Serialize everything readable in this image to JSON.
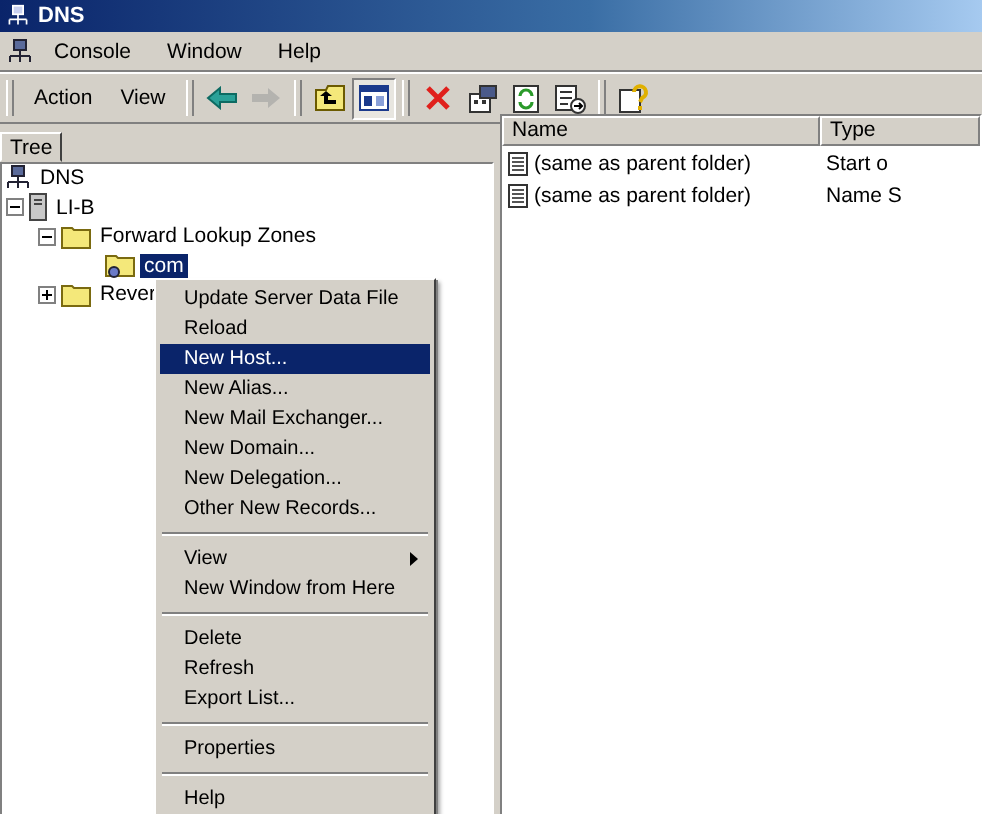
{
  "window": {
    "title": "DNS"
  },
  "menu_bar": [
    {
      "label": "Console"
    },
    {
      "label": "Window"
    },
    {
      "label": "Help"
    }
  ],
  "toolbar": {
    "menus": [
      {
        "label": "Action"
      },
      {
        "label": "View"
      }
    ],
    "buttons": [
      {
        "kind": "back",
        "disabled": false,
        "pressed": false
      },
      {
        "kind": "forward",
        "disabled": true,
        "pressed": false
      },
      {
        "kind": "up",
        "disabled": false,
        "pressed": false
      },
      {
        "kind": "tree",
        "disabled": false,
        "pressed": true
      },
      {
        "kind": "delete",
        "disabled": false,
        "pressed": false
      },
      {
        "kind": "properties",
        "disabled": false,
        "pressed": false
      },
      {
        "kind": "refresh",
        "disabled": false,
        "pressed": false
      },
      {
        "kind": "export",
        "disabled": false,
        "pressed": false
      },
      {
        "kind": "help",
        "disabled": false,
        "pressed": false
      }
    ]
  },
  "tabs": [
    {
      "label": "Tree",
      "selected": true
    }
  ],
  "tree": [
    {
      "label": "DNS",
      "kind": "dns",
      "expanded": true,
      "selected": false,
      "children": [
        {
          "label": "LI-B",
          "kind": "server",
          "expanded": true,
          "selected": false,
          "children": [
            {
              "label": "Forward Lookup Zones",
              "kind": "folder",
              "expanded": true,
              "selected": false,
              "children": [
                {
                  "label": "com",
                  "kind": "zone",
                  "selected": true
                }
              ]
            },
            {
              "label": "Rever",
              "kind": "folder",
              "expanded": false,
              "selected": false
            }
          ]
        }
      ]
    }
  ],
  "list": {
    "columns": [
      "Name",
      "Type"
    ],
    "rows": [
      {
        "name": "(same as parent folder)",
        "type": "Start o"
      },
      {
        "name": "(same as parent folder)",
        "type": "Name S"
      }
    ]
  },
  "context_menu": [
    {
      "kind": "item",
      "label": "Update Server Data File",
      "selected": false
    },
    {
      "kind": "item",
      "label": "Reload",
      "selected": false
    },
    {
      "kind": "item",
      "label": "New Host...",
      "selected": true
    },
    {
      "kind": "item",
      "label": "New Alias...",
      "selected": false
    },
    {
      "kind": "item",
      "label": "New Mail Exchanger...",
      "selected": false
    },
    {
      "kind": "item",
      "label": "New Domain...",
      "selected": false
    },
    {
      "kind": "item",
      "label": "New Delegation...",
      "selected": false
    },
    {
      "kind": "item",
      "label": "Other New Records...",
      "selected": false
    },
    {
      "kind": "separator"
    },
    {
      "kind": "submenu",
      "label": "View",
      "selected": false
    },
    {
      "kind": "item",
      "label": "New Window from Here",
      "selected": false
    },
    {
      "kind": "separator"
    },
    {
      "kind": "item",
      "label": "Delete",
      "selected": false
    },
    {
      "kind": "item",
      "label": "Refresh",
      "selected": false
    },
    {
      "kind": "item",
      "label": "Export List...",
      "selected": false
    },
    {
      "kind": "separator"
    },
    {
      "kind": "item",
      "label": "Properties",
      "selected": false
    },
    {
      "kind": "separator"
    },
    {
      "kind": "item",
      "label": "Help",
      "selected": false
    }
  ]
}
